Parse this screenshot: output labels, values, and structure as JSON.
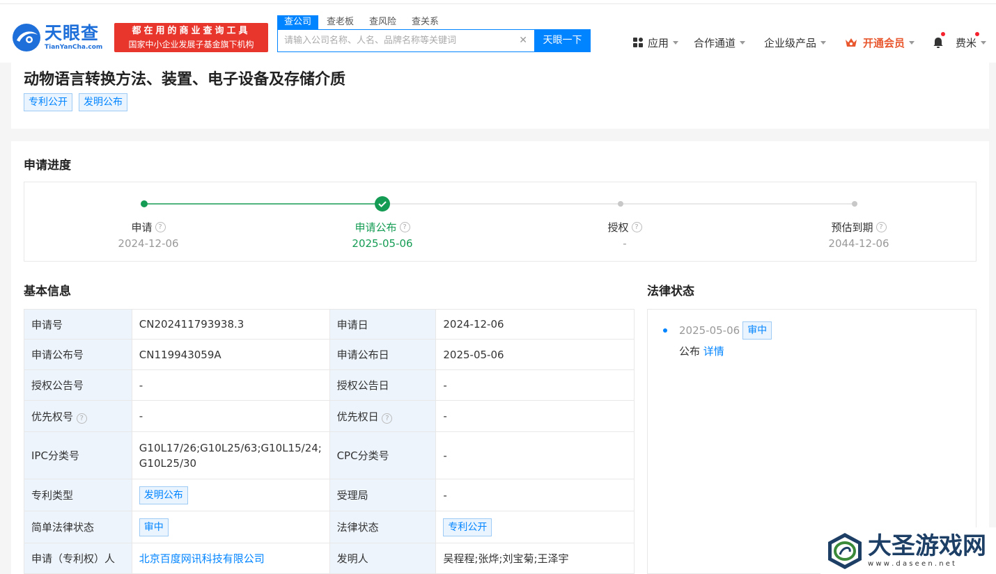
{
  "header": {
    "logo_cn": "天眼查",
    "logo_en": "TianYanCha.com",
    "slogan_line1": "都在用的商业查询工具",
    "slogan_line2": "国家中小企业发展子基金旗下机构",
    "search_tabs": [
      "查公司",
      "查老板",
      "查风险",
      "查关系"
    ],
    "search_placeholder": "请输入公司名称、人名、品牌名称等关键词",
    "search_button": "天眼一下",
    "nav": {
      "apps": "应用",
      "partners": "合作通道",
      "enterprise": "企业级产品",
      "vip": "开通会员",
      "user": "费米"
    }
  },
  "patent": {
    "title": "动物语言转换方法、装置、电子设备及存储介质",
    "tags": [
      "专利公开",
      "发明公布"
    ]
  },
  "progress": {
    "section_title": "申请进度",
    "steps": [
      {
        "label": "申请",
        "date": "2024-12-06"
      },
      {
        "label": "申请公布",
        "date": "2025-05-06"
      },
      {
        "label": "授权",
        "date": "-"
      },
      {
        "label": "预估到期",
        "date": "2044-12-06"
      }
    ]
  },
  "basic_info": {
    "section_title": "基本信息",
    "rows": [
      {
        "l1": "申请号",
        "v1": "CN202411793938.3",
        "l2": "申请日",
        "v2": "2024-12-06"
      },
      {
        "l1": "申请公布号",
        "v1": "CN119943059A",
        "l2": "申请公布日",
        "v2": "2025-05-06"
      },
      {
        "l1": "授权公告号",
        "v1": "-",
        "l2": "授权公告日",
        "v2": "-"
      },
      {
        "l1": "优先权号",
        "v1": "-",
        "l2": "优先权日",
        "v2": "-"
      },
      {
        "l1": "IPC分类号",
        "v1": "G10L17/26;G10L25/63;G10L15/24;G10L25/30",
        "l2": "CPC分类号",
        "v2": "-"
      },
      {
        "l1": "专利类型",
        "v1": "发明公布",
        "l2": "受理局",
        "v2": "-"
      },
      {
        "l1": "简单法律状态",
        "v1": "审中",
        "l2": "法律状态",
        "v2": "专利公开"
      },
      {
        "l1": "申请（专利权）人",
        "v1": "北京百度网讯科技有限公司",
        "l2": "发明人",
        "v2": "吴程程;张烨;刘宝菊;王泽宇"
      }
    ]
  },
  "legal_status": {
    "section_title": "法律状态",
    "items": [
      {
        "date": "2025-05-06",
        "badge": "审中",
        "desc": "公布",
        "link": "详情"
      }
    ]
  },
  "watermark": {
    "title": "大圣游戏网",
    "url": "w w w . d a s e e n . n e t"
  },
  "colors": {
    "brand": "#0084ff",
    "success": "#159c54",
    "vip": "#e8572d",
    "slogan_bg": "#e8362d"
  }
}
